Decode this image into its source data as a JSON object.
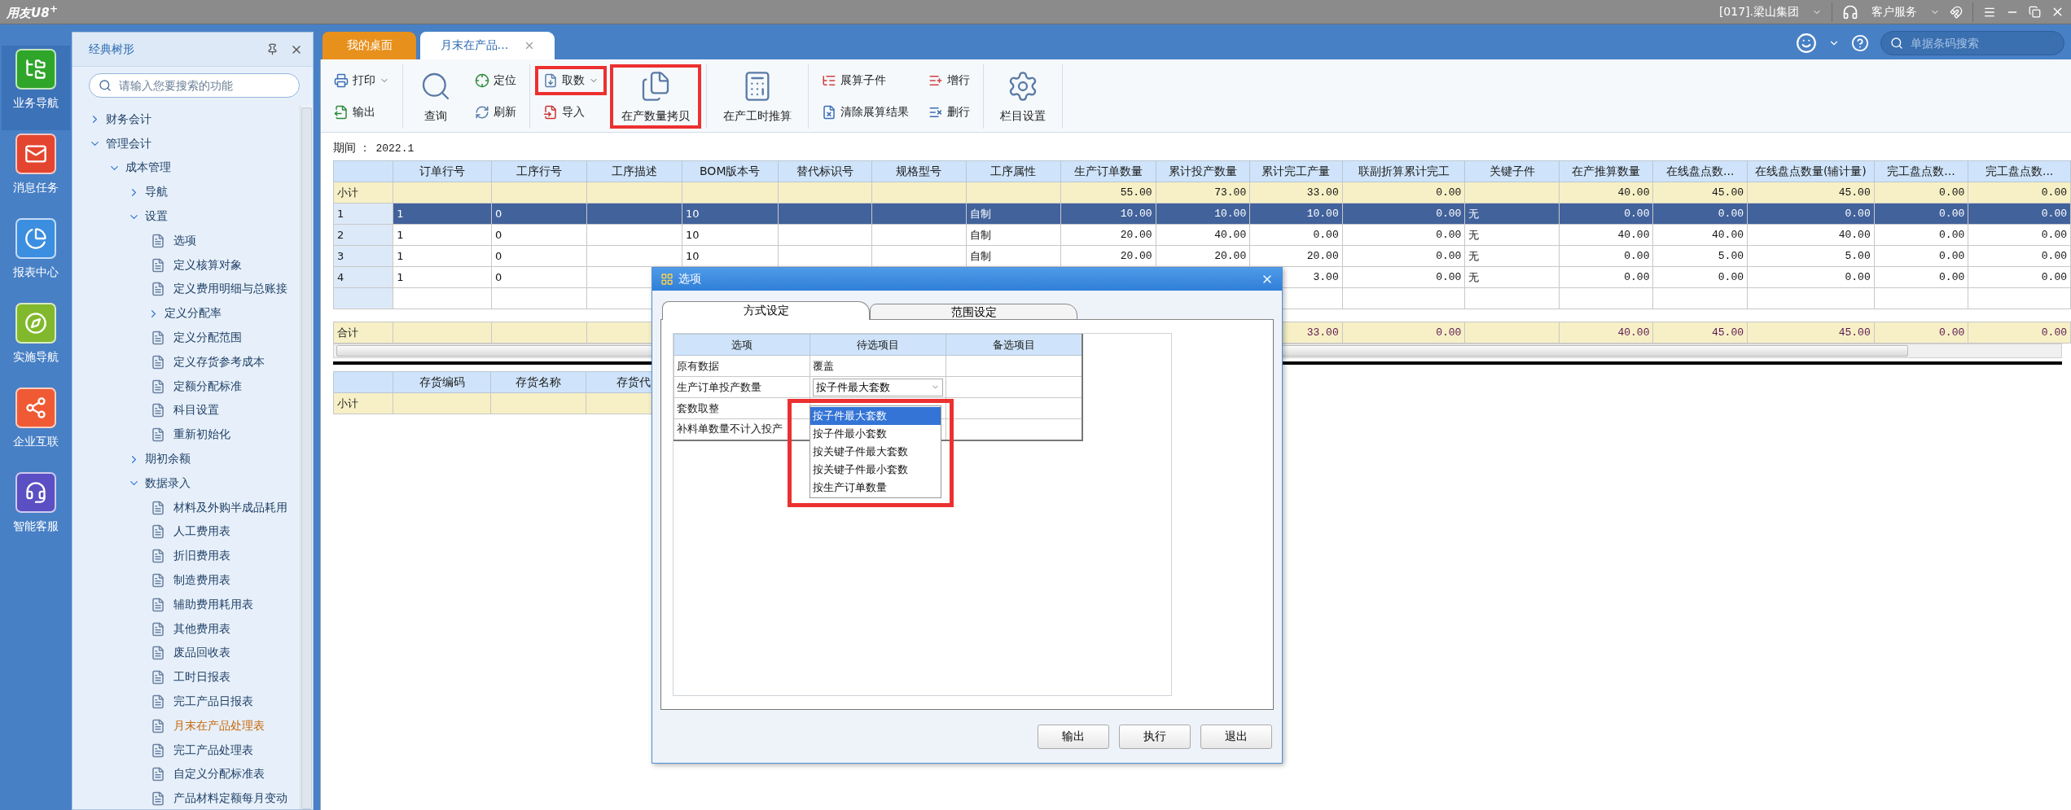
{
  "title_bar": {
    "logo": "用友U8$^{+}$",
    "company": "[017].梁山集团",
    "service": "客户服务"
  },
  "nav": [
    {
      "label": "业务导航",
      "selected": true
    },
    {
      "label": "消息任务",
      "selected": false
    },
    {
      "label": "报表中心",
      "selected": false
    },
    {
      "label": "实施导航",
      "selected": false
    },
    {
      "label": "企业互联",
      "selected": false
    },
    {
      "label": "智能客服",
      "selected": false
    }
  ],
  "tree_panel": {
    "title": "经典树形",
    "search_placeholder": "请输入您要搜索的功能",
    "items": [
      {
        "label": "财务会计",
        "expanded": false
      },
      {
        "label": "管理会计",
        "expanded": true,
        "children": [
          {
            "label": "成本管理",
            "expanded": true,
            "children": [
              {
                "label": "导航",
                "expanded": false
              },
              {
                "label": "设置",
                "expanded": true,
                "children": [
                  {
                    "label": "选项",
                    "selected": false
                  },
                  {
                    "label": "定义核算对象",
                    "selected": false
                  },
                  {
                    "label": "定义费用明细与总账接",
                    "selected": false
                  },
                  {
                    "label": "定义分配率",
                    "expanded": false
                  },
                  {
                    "label": "定义分配范围",
                    "selected": false
                  },
                  {
                    "label": "定义存货参考成本",
                    "selected": false
                  },
                  {
                    "label": "定额分配标准",
                    "selected": false
                  },
                  {
                    "label": "科目设置",
                    "selected": false
                  },
                  {
                    "label": "重新初始化",
                    "selected": false
                  }
                ]
              },
              {
                "label": "期初余额",
                "expanded": false
              },
              {
                "label": "数据录入",
                "expanded": true,
                "children": [
                  {
                    "label": "材料及外购半成品耗用",
                    "selected": false
                  },
                  {
                    "label": "人工费用表",
                    "selected": false
                  },
                  {
                    "label": "折旧费用表",
                    "selected": false
                  },
                  {
                    "label": "制造费用表",
                    "selected": false
                  },
                  {
                    "label": "辅助费用耗用表",
                    "selected": false
                  },
                  {
                    "label": "其他费用表",
                    "selected": false
                  },
                  {
                    "label": "废品回收表",
                    "selected": false
                  },
                  {
                    "label": "工时日报表",
                    "selected": false
                  },
                  {
                    "label": "完工产品日报表",
                    "selected": false
                  },
                  {
                    "label": "月末在产品处理表",
                    "selected": true
                  },
                  {
                    "label": "完工产品处理表",
                    "selected": false
                  },
                  {
                    "label": "自定义分配标准表",
                    "selected": false
                  },
                  {
                    "label": "产品材料定额每月变动",
                    "selected": false
                  }
                ]
              }
            ]
          }
        ]
      }
    ]
  },
  "tabs": [
    {
      "label": "我的桌面",
      "selected": false
    },
    {
      "label": "月末在产品…",
      "selected": true,
      "closable": true
    }
  ],
  "barcode_search": {
    "placeholder": "单据条码搜索"
  },
  "toolbar": [
    {
      "items": [
        {
          "kind": "stack",
          "buttons": [
            {
              "label": "打印",
              "dropdown": true
            },
            {
              "label": "输出"
            }
          ]
        }
      ]
    },
    {
      "items": [
        {
          "kind": "large",
          "buttons": [
            {
              "label": "查询"
            }
          ]
        },
        {
          "kind": "stack",
          "buttons": [
            {
              "label": "定位"
            },
            {
              "label": "刷新"
            }
          ]
        }
      ]
    },
    {
      "items": [
        {
          "kind": "stack",
          "buttons": [
            {
              "label": "取数",
              "dropdown": true,
              "highlighted": true
            },
            {
              "label": "导入"
            }
          ]
        },
        {
          "kind": "large",
          "buttons": [
            {
              "label": "在产数量拷贝",
              "highlighted": true
            }
          ]
        }
      ]
    },
    {
      "items": [
        {
          "kind": "large",
          "buttons": [
            {
              "label": "在产工时推算"
            }
          ]
        }
      ]
    },
    {
      "items": [
        {
          "kind": "stack",
          "buttons": [
            {
              "label": "展算子件"
            },
            {
              "label": "清除展算结果"
            }
          ]
        },
        {
          "kind": "stack",
          "buttons": [
            {
              "label": "增行"
            },
            {
              "label": "删行"
            }
          ]
        }
      ]
    },
    {
      "items": [
        {
          "kind": "large",
          "buttons": [
            {
              "label": "栏目设置"
            }
          ]
        }
      ]
    }
  ],
  "period": {
    "label": "期间 ：",
    "value": "2022.1"
  },
  "grid": {
    "columns": [
      {
        "label": "订单行号",
        "kind": "text"
      },
      {
        "label": "工序行号",
        "kind": "text"
      },
      {
        "label": "工序描述",
        "kind": "text"
      },
      {
        "label": "BOM版本号",
        "kind": "text"
      },
      {
        "label": "替代标识号",
        "kind": "text"
      },
      {
        "label": "规格型号",
        "kind": "text"
      },
      {
        "label": "工序属性",
        "kind": "text"
      },
      {
        "label": "生产订单数量",
        "kind": "number"
      },
      {
        "label": "累计投产数量",
        "kind": "number"
      },
      {
        "label": "累计完工产量",
        "kind": "number"
      },
      {
        "label": "联副折算累计完工",
        "kind": "number"
      },
      {
        "label": "关键子件",
        "kind": "text"
      },
      {
        "label": "在产推算数量",
        "kind": "number"
      },
      {
        "label": "在线盘点数...",
        "kind": "number"
      },
      {
        "label": "在线盘点数量(辅计量)",
        "kind": "number"
      },
      {
        "label": "完工盘点数...",
        "kind": "number"
      },
      {
        "label": "完工盘点数...",
        "kind": "number"
      }
    ],
    "rows": [
      {
        "kind": "subtotal",
        "label": "小计",
        "selected": false,
        "cells": [
          null,
          null,
          null,
          null,
          null,
          null,
          null,
          "55.00",
          "73.00",
          "33.00",
          "0.00",
          null,
          "40.00",
          "45.00",
          "45.00",
          "0.00",
          "0.00"
        ]
      },
      {
        "kind": "data",
        "label": "1",
        "selected": true,
        "cells": [
          "1",
          "0",
          null,
          "10",
          null,
          null,
          "自制",
          "10.00",
          "10.00",
          "10.00",
          "0.00",
          "无",
          "0.00",
          "0.00",
          "0.00",
          "0.00",
          "0.00"
        ]
      },
      {
        "kind": "data",
        "label": "2",
        "selected": false,
        "cells": [
          "1",
          "0",
          null,
          "10",
          null,
          null,
          "自制",
          "20.00",
          "40.00",
          "0.00",
          "0.00",
          "无",
          "40.00",
          "40.00",
          "40.00",
          "0.00",
          "0.00"
        ]
      },
      {
        "kind": "data",
        "label": "3",
        "selected": false,
        "cells": [
          "1",
          "0",
          null,
          "10",
          null,
          null,
          "自制",
          "20.00",
          "20.00",
          "20.00",
          "0.00",
          "无",
          "0.00",
          "5.00",
          "5.00",
          "0.00",
          "0.00"
        ]
      },
      {
        "kind": "data",
        "label": "4",
        "selected": false,
        "cells": [
          "1",
          "0",
          null,
          null,
          null,
          null,
          null,
          null,
          null,
          "3.00",
          "0.00",
          "无",
          "0.00",
          "0.00",
          "0.00",
          "0.00",
          "0.00"
        ]
      },
      {
        "kind": "blank",
        "selected": false
      }
    ],
    "total": {
      "label": "合计",
      "cells": [
        null,
        null,
        null,
        null,
        null,
        null,
        null,
        null,
        null,
        "33.00",
        "0.00",
        null,
        "40.00",
        "45.00",
        "45.00",
        "0.00",
        "0.00"
      ]
    }
  },
  "detail_grid": {
    "columns": [
      "存货编码",
      "存货名称",
      "存货代"
    ],
    "rows": [
      {
        "label": "小计"
      }
    ]
  },
  "dialog": {
    "title": "选项",
    "tabs": [
      {
        "label": "方式设定",
        "selected": true
      },
      {
        "label": "范围设定",
        "selected": false
      }
    ],
    "columns": [
      "选项",
      "待选项目",
      "备选项目"
    ],
    "rows": [
      {
        "kind": "text",
        "label": "原有数据",
        "value": "覆盖"
      },
      {
        "kind": "select",
        "label": "生产订单投产数量",
        "value": "按子件最大套数"
      },
      {
        "kind": "text",
        "label": "套数取整"
      },
      {
        "kind": "text",
        "label": "补料单数量不计入投产"
      }
    ],
    "dropdown": {
      "highlighted": true,
      "options": [
        {
          "label": "按子件最大套数",
          "selected": true
        },
        {
          "label": "按子件最小套数",
          "selected": false
        },
        {
          "label": "按关键子件最大套数",
          "selected": false
        },
        {
          "label": "按关键子件最小套数",
          "selected": false
        },
        {
          "label": "按生产订单数量",
          "selected": false
        }
      ]
    },
    "buttons": [
      "输出",
      "执行",
      "退出"
    ]
  }
}
